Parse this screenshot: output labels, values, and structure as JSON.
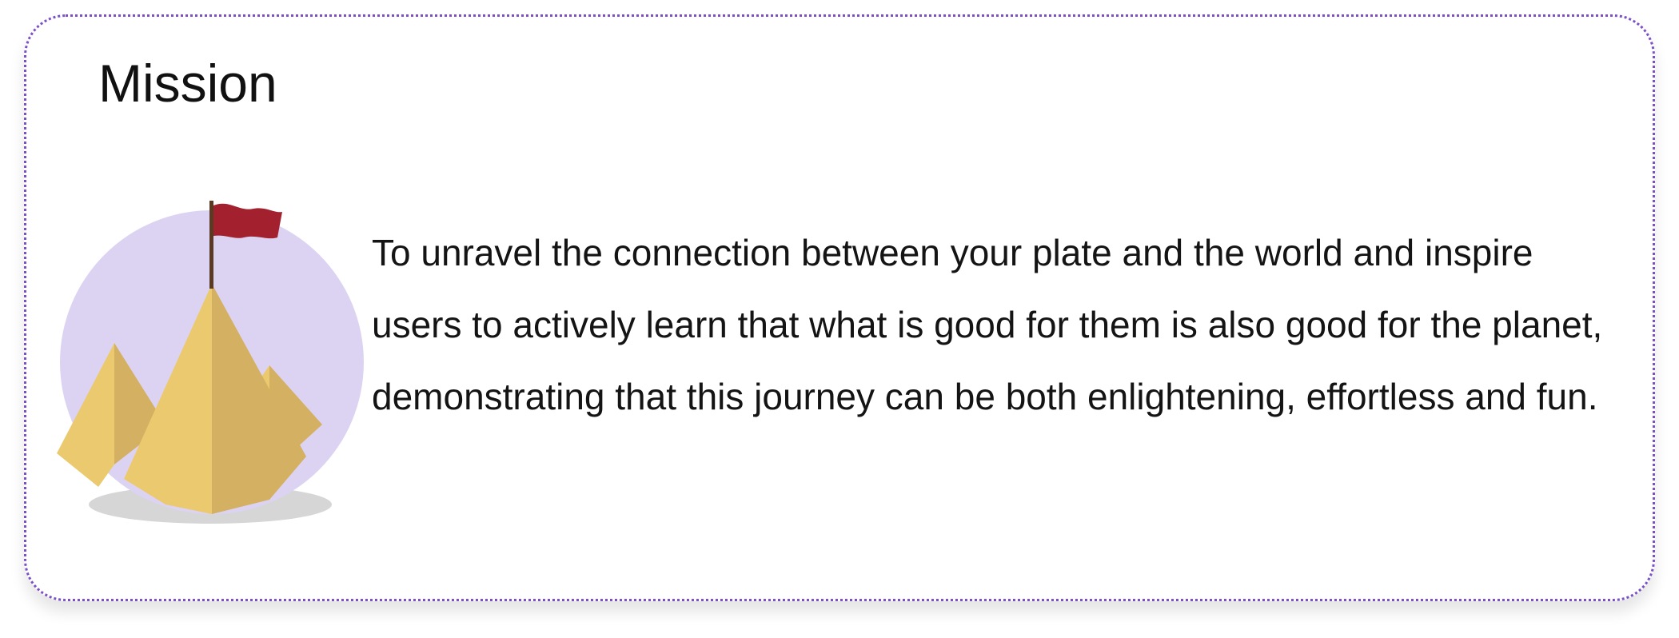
{
  "mission": {
    "title": "Mission",
    "body": "To unravel the connection between your plate and the world and inspire users to actively learn that what is good for them is also good for the planet, demonstrating that this journey can be both enlightening, effortless and fun."
  },
  "illustration": {
    "icon": "mountain-flag-icon",
    "colors": {
      "circle": "#dcd3f3",
      "mountain_light": "#ebc96f",
      "mountain_dark": "#d4b063",
      "flag": "#a3202e",
      "pole": "#5a3a22",
      "shadow": "#d6d6d6"
    }
  },
  "card": {
    "border_color": "#7b4fc7"
  }
}
